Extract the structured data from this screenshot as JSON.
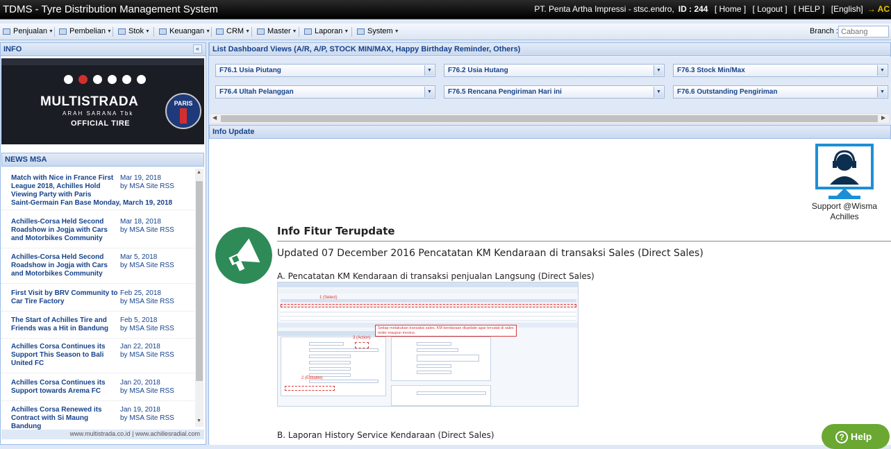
{
  "titlebar": {
    "app_title": "TDMS - Tyre Distribution Management System",
    "company": "PT. Penta Artha Impressi - stsc.endro,",
    "id_label": "ID : 244",
    "home": "[ Home ]",
    "logout": "[ Logout ]",
    "help": "[ HELP ]",
    "language": "[English]",
    "arrow": "→ AC"
  },
  "menu": {
    "items": [
      {
        "label": "Penjualan"
      },
      {
        "label": "Pembelian"
      },
      {
        "label": "Stok"
      },
      {
        "label": "Keuangan"
      },
      {
        "label": "CRM"
      },
      {
        "label": "Master"
      },
      {
        "label": "Laporan"
      },
      {
        "label": "System"
      }
    ],
    "branch_label": "Branch :",
    "branch_placeholder": "Cabang"
  },
  "info_panel": {
    "title": "INFO",
    "collapse": "«",
    "banner": {
      "brand": "MULTISTRADA",
      "brand_sub": "ARAH SARANA Tbk",
      "official": "OFFICIAL TIRE",
      "club": "PARIS"
    }
  },
  "news": {
    "title": "NEWS MSA",
    "items": [
      {
        "title": "Match with Nice in France First League 2018, Achilles Hold Viewing Party with Paris",
        "title_cont": "Saint-Germain Fan Base Monday, March 19, 2018",
        "date": "Mar 19, 2018",
        "source": "by MSA Site RSS"
      },
      {
        "title": "Achilles-Corsa Held Second Roadshow in Jogja with Cars and Motorbikes Community",
        "date": "Mar 18, 2018",
        "source": "by MSA Site RSS"
      },
      {
        "title": "Achilles-Corsa Held Second Roadshow in Jogja with Cars and Motorbikes Community",
        "date": "Mar 5, 2018",
        "source": "by MSA Site RSS"
      },
      {
        "title": "First Visit by BRV Community to Car Tire Factory",
        "date": "Feb 25, 2018",
        "source": "by MSA Site RSS"
      },
      {
        "title": "The Start of Achilles Tire and Friends was a Hit in Bandung",
        "date": "Feb 5, 2018",
        "source": "by MSA Site RSS"
      },
      {
        "title": "Achilles Corsa Continues its Support This Season to Bali United FC",
        "date": "Jan 22, 2018",
        "source": "by MSA Site RSS"
      },
      {
        "title": "Achilles Corsa Continues its Support towards Arema FC",
        "date": "Jan 20, 2018",
        "source": "by MSA Site RSS"
      },
      {
        "title": "Achilles Corsa Renewed its Contract with Si Maung Bandung",
        "date": "Jan 19, 2018",
        "source": "by MSA Site RSS"
      }
    ],
    "footer": "www.multistrada.co.id | www.achillesradial.com"
  },
  "dashboard": {
    "title": "List Dashboard Views (A/R, A/P, STOCK MIN/MAX, Happy Birthday Reminder, Others)",
    "combos": [
      {
        "label": "F76.1 Usia Piutang"
      },
      {
        "label": "F76.2 Usia Hutang"
      },
      {
        "label": "F76.3 Stock Min/Max"
      },
      {
        "label": "F76.4 Ultah Pelanggan"
      },
      {
        "label": "F76.5 Rencana Pengiriman Hari ini"
      },
      {
        "label": "F76.6 Outstanding Pengiriman"
      }
    ]
  },
  "info_update": {
    "title": "Info Update",
    "support": "Support @Wisma Achilles",
    "heading": "Info Fitur Terupdate",
    "updated": "Updated 07 December 2016 Pencatatan KM Kendaraan di transaksi Sales (Direct Sales)",
    "section_a": "A. Pencatatan KM Kendaraan di transaksi penjualan Langsung (Direct Sales)",
    "section_b": "B. Laporan History Service Kendaraan (Direct Sales)",
    "screenshot": {
      "label_select": "1 (Select)",
      "label_action": "3 (Action)",
      "label_editable": "2 (Editable)",
      "note": "Setiap melakukan transaksi sales, KM kendaraan diupdate agar tercatat di sales order maupun invoice."
    }
  },
  "help_button": "Help"
}
